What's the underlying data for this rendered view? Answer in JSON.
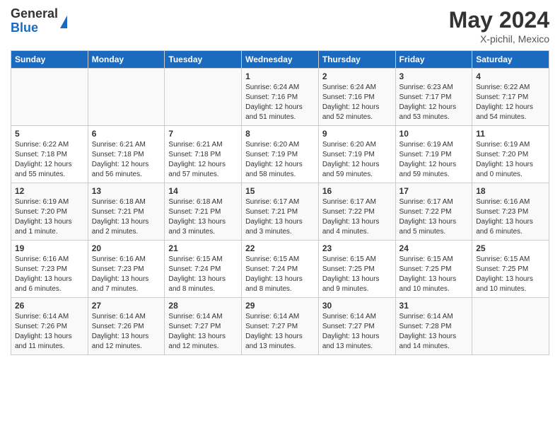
{
  "header": {
    "logo_general": "General",
    "logo_blue": "Blue",
    "month_year": "May 2024",
    "location": "X-pichil, Mexico"
  },
  "days_of_week": [
    "Sunday",
    "Monday",
    "Tuesday",
    "Wednesday",
    "Thursday",
    "Friday",
    "Saturday"
  ],
  "weeks": [
    {
      "days": [
        {
          "number": "",
          "info": ""
        },
        {
          "number": "",
          "info": ""
        },
        {
          "number": "",
          "info": ""
        },
        {
          "number": "1",
          "info": "Sunrise: 6:24 AM\nSunset: 7:16 PM\nDaylight: 12 hours\nand 51 minutes."
        },
        {
          "number": "2",
          "info": "Sunrise: 6:24 AM\nSunset: 7:16 PM\nDaylight: 12 hours\nand 52 minutes."
        },
        {
          "number": "3",
          "info": "Sunrise: 6:23 AM\nSunset: 7:17 PM\nDaylight: 12 hours\nand 53 minutes."
        },
        {
          "number": "4",
          "info": "Sunrise: 6:22 AM\nSunset: 7:17 PM\nDaylight: 12 hours\nand 54 minutes."
        }
      ]
    },
    {
      "days": [
        {
          "number": "5",
          "info": "Sunrise: 6:22 AM\nSunset: 7:18 PM\nDaylight: 12 hours\nand 55 minutes."
        },
        {
          "number": "6",
          "info": "Sunrise: 6:21 AM\nSunset: 7:18 PM\nDaylight: 12 hours\nand 56 minutes."
        },
        {
          "number": "7",
          "info": "Sunrise: 6:21 AM\nSunset: 7:18 PM\nDaylight: 12 hours\nand 57 minutes."
        },
        {
          "number": "8",
          "info": "Sunrise: 6:20 AM\nSunset: 7:19 PM\nDaylight: 12 hours\nand 58 minutes."
        },
        {
          "number": "9",
          "info": "Sunrise: 6:20 AM\nSunset: 7:19 PM\nDaylight: 12 hours\nand 59 minutes."
        },
        {
          "number": "10",
          "info": "Sunrise: 6:19 AM\nSunset: 7:19 PM\nDaylight: 12 hours\nand 59 minutes."
        },
        {
          "number": "11",
          "info": "Sunrise: 6:19 AM\nSunset: 7:20 PM\nDaylight: 13 hours\nand 0 minutes."
        }
      ]
    },
    {
      "days": [
        {
          "number": "12",
          "info": "Sunrise: 6:19 AM\nSunset: 7:20 PM\nDaylight: 13 hours\nand 1 minute."
        },
        {
          "number": "13",
          "info": "Sunrise: 6:18 AM\nSunset: 7:21 PM\nDaylight: 13 hours\nand 2 minutes."
        },
        {
          "number": "14",
          "info": "Sunrise: 6:18 AM\nSunset: 7:21 PM\nDaylight: 13 hours\nand 3 minutes."
        },
        {
          "number": "15",
          "info": "Sunrise: 6:17 AM\nSunset: 7:21 PM\nDaylight: 13 hours\nand 3 minutes."
        },
        {
          "number": "16",
          "info": "Sunrise: 6:17 AM\nSunset: 7:22 PM\nDaylight: 13 hours\nand 4 minutes."
        },
        {
          "number": "17",
          "info": "Sunrise: 6:17 AM\nSunset: 7:22 PM\nDaylight: 13 hours\nand 5 minutes."
        },
        {
          "number": "18",
          "info": "Sunrise: 6:16 AM\nSunset: 7:23 PM\nDaylight: 13 hours\nand 6 minutes."
        }
      ]
    },
    {
      "days": [
        {
          "number": "19",
          "info": "Sunrise: 6:16 AM\nSunset: 7:23 PM\nDaylight: 13 hours\nand 6 minutes."
        },
        {
          "number": "20",
          "info": "Sunrise: 6:16 AM\nSunset: 7:23 PM\nDaylight: 13 hours\nand 7 minutes."
        },
        {
          "number": "21",
          "info": "Sunrise: 6:15 AM\nSunset: 7:24 PM\nDaylight: 13 hours\nand 8 minutes."
        },
        {
          "number": "22",
          "info": "Sunrise: 6:15 AM\nSunset: 7:24 PM\nDaylight: 13 hours\nand 8 minutes."
        },
        {
          "number": "23",
          "info": "Sunrise: 6:15 AM\nSunset: 7:25 PM\nDaylight: 13 hours\nand 9 minutes."
        },
        {
          "number": "24",
          "info": "Sunrise: 6:15 AM\nSunset: 7:25 PM\nDaylight: 13 hours\nand 10 minutes."
        },
        {
          "number": "25",
          "info": "Sunrise: 6:15 AM\nSunset: 7:25 PM\nDaylight: 13 hours\nand 10 minutes."
        }
      ]
    },
    {
      "days": [
        {
          "number": "26",
          "info": "Sunrise: 6:14 AM\nSunset: 7:26 PM\nDaylight: 13 hours\nand 11 minutes."
        },
        {
          "number": "27",
          "info": "Sunrise: 6:14 AM\nSunset: 7:26 PM\nDaylight: 13 hours\nand 12 minutes."
        },
        {
          "number": "28",
          "info": "Sunrise: 6:14 AM\nSunset: 7:27 PM\nDaylight: 13 hours\nand 12 minutes."
        },
        {
          "number": "29",
          "info": "Sunrise: 6:14 AM\nSunset: 7:27 PM\nDaylight: 13 hours\nand 13 minutes."
        },
        {
          "number": "30",
          "info": "Sunrise: 6:14 AM\nSunset: 7:27 PM\nDaylight: 13 hours\nand 13 minutes."
        },
        {
          "number": "31",
          "info": "Sunrise: 6:14 AM\nSunset: 7:28 PM\nDaylight: 13 hours\nand 14 minutes."
        },
        {
          "number": "",
          "info": ""
        }
      ]
    }
  ]
}
